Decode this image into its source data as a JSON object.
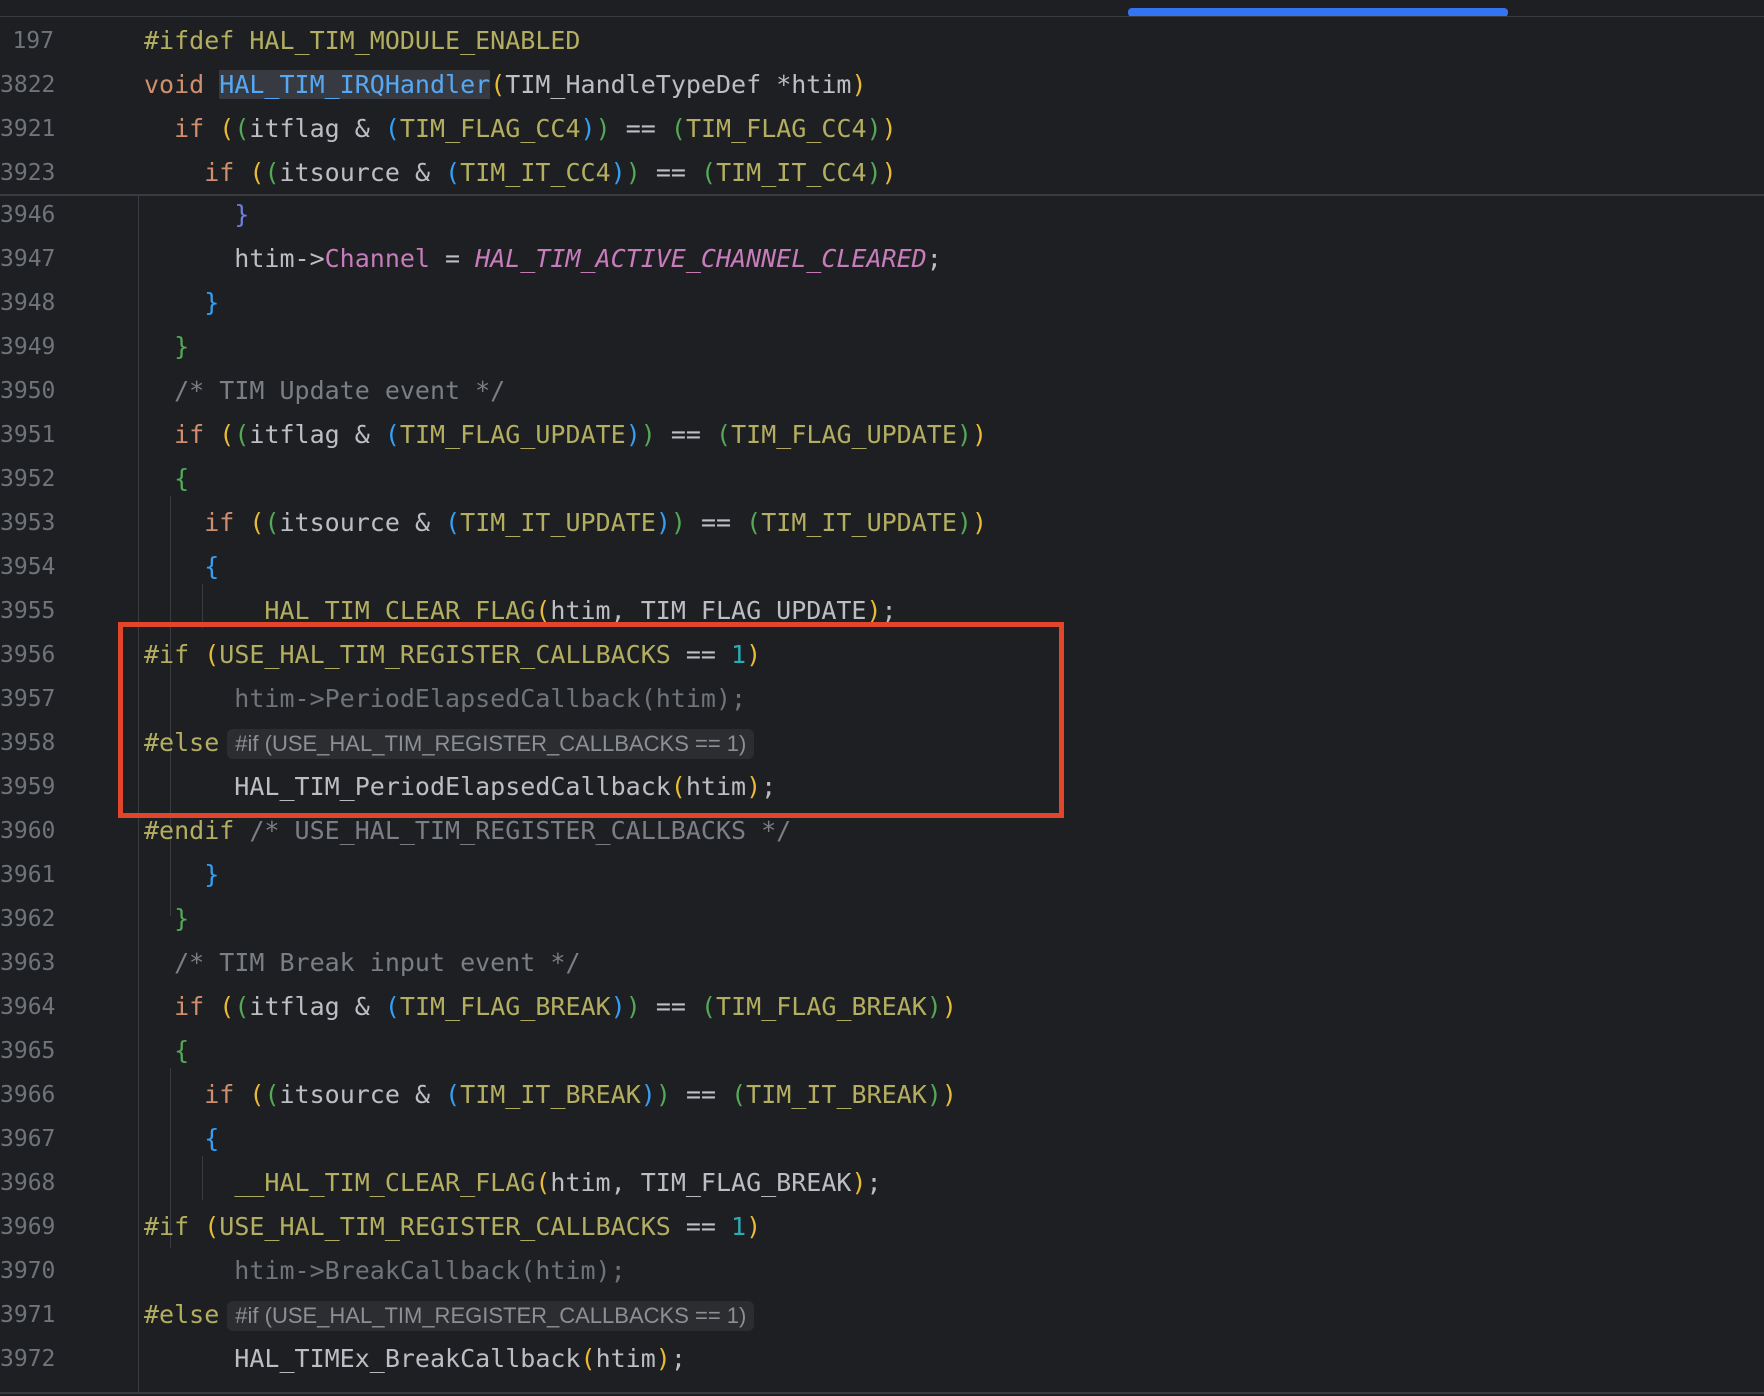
{
  "lines": [
    {
      "n": "197",
      "tokens": [
        [
          "pp",
          "#ifdef "
        ],
        [
          "mac",
          "HAL_TIM_MODULE_ENABLED"
        ]
      ]
    },
    {
      "n": "3822",
      "tokens": [
        [
          "kw",
          "void "
        ],
        [
          "fn-hl",
          "HAL_TIM_IRQHandler"
        ],
        [
          "p1",
          "("
        ],
        [
          "id",
          "TIM_HandleTypeDef *htim"
        ],
        [
          "p1",
          ")"
        ]
      ]
    },
    {
      "n": "3921",
      "tokens": [
        [
          "id",
          "  "
        ],
        [
          "kw",
          "if "
        ],
        [
          "p1",
          "("
        ],
        [
          "p2",
          "("
        ],
        [
          "id",
          "itflag & "
        ],
        [
          "p3",
          "("
        ],
        [
          "mac",
          "TIM_FLAG_CC4"
        ],
        [
          "p3",
          ")"
        ],
        [
          "p2",
          ")"
        ],
        [
          "id",
          " == "
        ],
        [
          "p2",
          "("
        ],
        [
          "mac",
          "TIM_FLAG_CC4"
        ],
        [
          "p2",
          ")"
        ],
        [
          "p1",
          ")"
        ]
      ]
    },
    {
      "n": "3923",
      "tokens": [
        [
          "id",
          "    "
        ],
        [
          "kw",
          "if "
        ],
        [
          "p1",
          "("
        ],
        [
          "p2",
          "("
        ],
        [
          "id",
          "itsource & "
        ],
        [
          "p3",
          "("
        ],
        [
          "mac",
          "TIM_IT_CC4"
        ],
        [
          "p3",
          ")"
        ],
        [
          "p2",
          ")"
        ],
        [
          "id",
          " == "
        ],
        [
          "p2",
          "("
        ],
        [
          "mac",
          "TIM_IT_CC4"
        ],
        [
          "p2",
          ")"
        ],
        [
          "p1",
          ")"
        ]
      ]
    },
    {
      "n": "3946",
      "tokens": [
        [
          "id",
          "      "
        ],
        [
          "p4",
          "}"
        ]
      ]
    },
    {
      "n": "3947",
      "tokens": [
        [
          "id",
          "      htim->"
        ],
        [
          "field",
          "Channel"
        ],
        [
          "id",
          " = "
        ],
        [
          "ital",
          "HAL_TIM_ACTIVE_CHANNEL_CLEARED"
        ],
        [
          "id",
          ";"
        ]
      ]
    },
    {
      "n": "3948",
      "tokens": [
        [
          "id",
          "    "
        ],
        [
          "p3",
          "}"
        ]
      ]
    },
    {
      "n": "3949",
      "tokens": [
        [
          "id",
          "  "
        ],
        [
          "p2",
          "}"
        ]
      ]
    },
    {
      "n": "3950",
      "tokens": [
        [
          "id",
          "  "
        ],
        [
          "cm",
          "/* TIM Update event */"
        ]
      ]
    },
    {
      "n": "3951",
      "tokens": [
        [
          "id",
          "  "
        ],
        [
          "kw",
          "if "
        ],
        [
          "p1",
          "("
        ],
        [
          "p2",
          "("
        ],
        [
          "id",
          "itflag & "
        ],
        [
          "p3",
          "("
        ],
        [
          "mac",
          "TIM_FLAG_UPDATE"
        ],
        [
          "p3",
          ")"
        ],
        [
          "p2",
          ")"
        ],
        [
          "id",
          " == "
        ],
        [
          "p2",
          "("
        ],
        [
          "mac",
          "TIM_FLAG_UPDATE"
        ],
        [
          "p2",
          ")"
        ],
        [
          "p1",
          ")"
        ]
      ]
    },
    {
      "n": "3952",
      "tokens": [
        [
          "id",
          "  "
        ],
        [
          "p2",
          "{"
        ]
      ]
    },
    {
      "n": "3953",
      "tokens": [
        [
          "id",
          "    "
        ],
        [
          "kw",
          "if "
        ],
        [
          "p1",
          "("
        ],
        [
          "p2",
          "("
        ],
        [
          "id",
          "itsource & "
        ],
        [
          "p3",
          "("
        ],
        [
          "mac",
          "TIM_IT_UPDATE"
        ],
        [
          "p3",
          ")"
        ],
        [
          "p2",
          ")"
        ],
        [
          "id",
          " == "
        ],
        [
          "p2",
          "("
        ],
        [
          "mac",
          "TIM_IT_UPDATE"
        ],
        [
          "p2",
          ")"
        ],
        [
          "p1",
          ")"
        ]
      ]
    },
    {
      "n": "3954",
      "tokens": [
        [
          "id",
          "    "
        ],
        [
          "p3",
          "{"
        ]
      ]
    },
    {
      "n": "3955",
      "tokens": [
        [
          "id",
          "      "
        ],
        [
          "mac",
          "__HAL_TIM_CLEAR_FLAG"
        ],
        [
          "p1",
          "("
        ],
        [
          "id",
          "htim, TIM_FLAG_UPDATE"
        ],
        [
          "p1",
          ")"
        ],
        [
          "id",
          ";"
        ]
      ]
    },
    {
      "n": "3956",
      "tokens": [
        [
          "pp",
          "#if "
        ],
        [
          "p1",
          "("
        ],
        [
          "mac",
          "USE_HAL_TIM_REGISTER_CALLBACKS"
        ],
        [
          "id",
          " == "
        ],
        [
          "num",
          "1"
        ],
        [
          "p1",
          ")"
        ]
      ]
    },
    {
      "n": "3957",
      "tokens": [
        [
          "dis",
          "      htim->PeriodElapsedCallback(htim);"
        ]
      ]
    },
    {
      "n": "3958",
      "tokens": [
        [
          "pp",
          "#else"
        ]
      ],
      "inlay": "#if (USE_HAL_TIM_REGISTER_CALLBACKS == 1)"
    },
    {
      "n": "3959",
      "tokens": [
        [
          "id",
          "      HAL_TIM_PeriodElapsedCallback"
        ],
        [
          "p1",
          "("
        ],
        [
          "id",
          "htim"
        ],
        [
          "p1",
          ")"
        ],
        [
          "id",
          ";"
        ]
      ]
    },
    {
      "n": "3960",
      "tokens": [
        [
          "pp",
          "#endif "
        ],
        [
          "cm",
          "/* USE_HAL_TIM_REGISTER_CALLBACKS */"
        ]
      ]
    },
    {
      "n": "3961",
      "tokens": [
        [
          "id",
          "    "
        ],
        [
          "p3",
          "}"
        ]
      ]
    },
    {
      "n": "3962",
      "tokens": [
        [
          "id",
          "  "
        ],
        [
          "p2",
          "}"
        ]
      ]
    },
    {
      "n": "3963",
      "tokens": [
        [
          "id",
          "  "
        ],
        [
          "cm",
          "/* TIM Break input event */"
        ]
      ]
    },
    {
      "n": "3964",
      "tokens": [
        [
          "id",
          "  "
        ],
        [
          "kw",
          "if "
        ],
        [
          "p1",
          "("
        ],
        [
          "p2",
          "("
        ],
        [
          "id",
          "itflag & "
        ],
        [
          "p3",
          "("
        ],
        [
          "mac",
          "TIM_FLAG_BREAK"
        ],
        [
          "p3",
          ")"
        ],
        [
          "p2",
          ")"
        ],
        [
          "id",
          " == "
        ],
        [
          "p2",
          "("
        ],
        [
          "mac",
          "TIM_FLAG_BREAK"
        ],
        [
          "p2",
          ")"
        ],
        [
          "p1",
          ")"
        ]
      ]
    },
    {
      "n": "3965",
      "tokens": [
        [
          "id",
          "  "
        ],
        [
          "p2",
          "{"
        ]
      ]
    },
    {
      "n": "3966",
      "tokens": [
        [
          "id",
          "    "
        ],
        [
          "kw",
          "if "
        ],
        [
          "p1",
          "("
        ],
        [
          "p2",
          "("
        ],
        [
          "id",
          "itsource & "
        ],
        [
          "p3",
          "("
        ],
        [
          "mac",
          "TIM_IT_BREAK"
        ],
        [
          "p3",
          ")"
        ],
        [
          "p2",
          ")"
        ],
        [
          "id",
          " == "
        ],
        [
          "p2",
          "("
        ],
        [
          "mac",
          "TIM_IT_BREAK"
        ],
        [
          "p2",
          ")"
        ],
        [
          "p1",
          ")"
        ]
      ]
    },
    {
      "n": "3967",
      "tokens": [
        [
          "id",
          "    "
        ],
        [
          "p3",
          "{"
        ]
      ]
    },
    {
      "n": "3968",
      "tokens": [
        [
          "id",
          "      "
        ],
        [
          "mac",
          "__HAL_TIM_CLEAR_FLAG"
        ],
        [
          "p1",
          "("
        ],
        [
          "id",
          "htim, TIM_FLAG_BREAK"
        ],
        [
          "p1",
          ")"
        ],
        [
          "id",
          ";"
        ]
      ]
    },
    {
      "n": "3969",
      "tokens": [
        [
          "pp",
          "#if "
        ],
        [
          "p1",
          "("
        ],
        [
          "mac",
          "USE_HAL_TIM_REGISTER_CALLBACKS"
        ],
        [
          "id",
          " == "
        ],
        [
          "num",
          "1"
        ],
        [
          "p1",
          ")"
        ]
      ]
    },
    {
      "n": "3970",
      "tokens": [
        [
          "dis",
          "      htim->BreakCallback(htim);"
        ]
      ]
    },
    {
      "n": "3971",
      "tokens": [
        [
          "pp",
          "#else"
        ]
      ],
      "inlay": "#if (USE_HAL_TIM_REGISTER_CALLBACKS == 1)"
    },
    {
      "n": "3972",
      "tokens": [
        [
          "id",
          "      HAL_TIMEx_BreakCallback"
        ],
        [
          "p1",
          "("
        ],
        [
          "id",
          "htim"
        ],
        [
          "p1",
          ")"
        ],
        [
          "id",
          ";"
        ]
      ]
    }
  ]
}
